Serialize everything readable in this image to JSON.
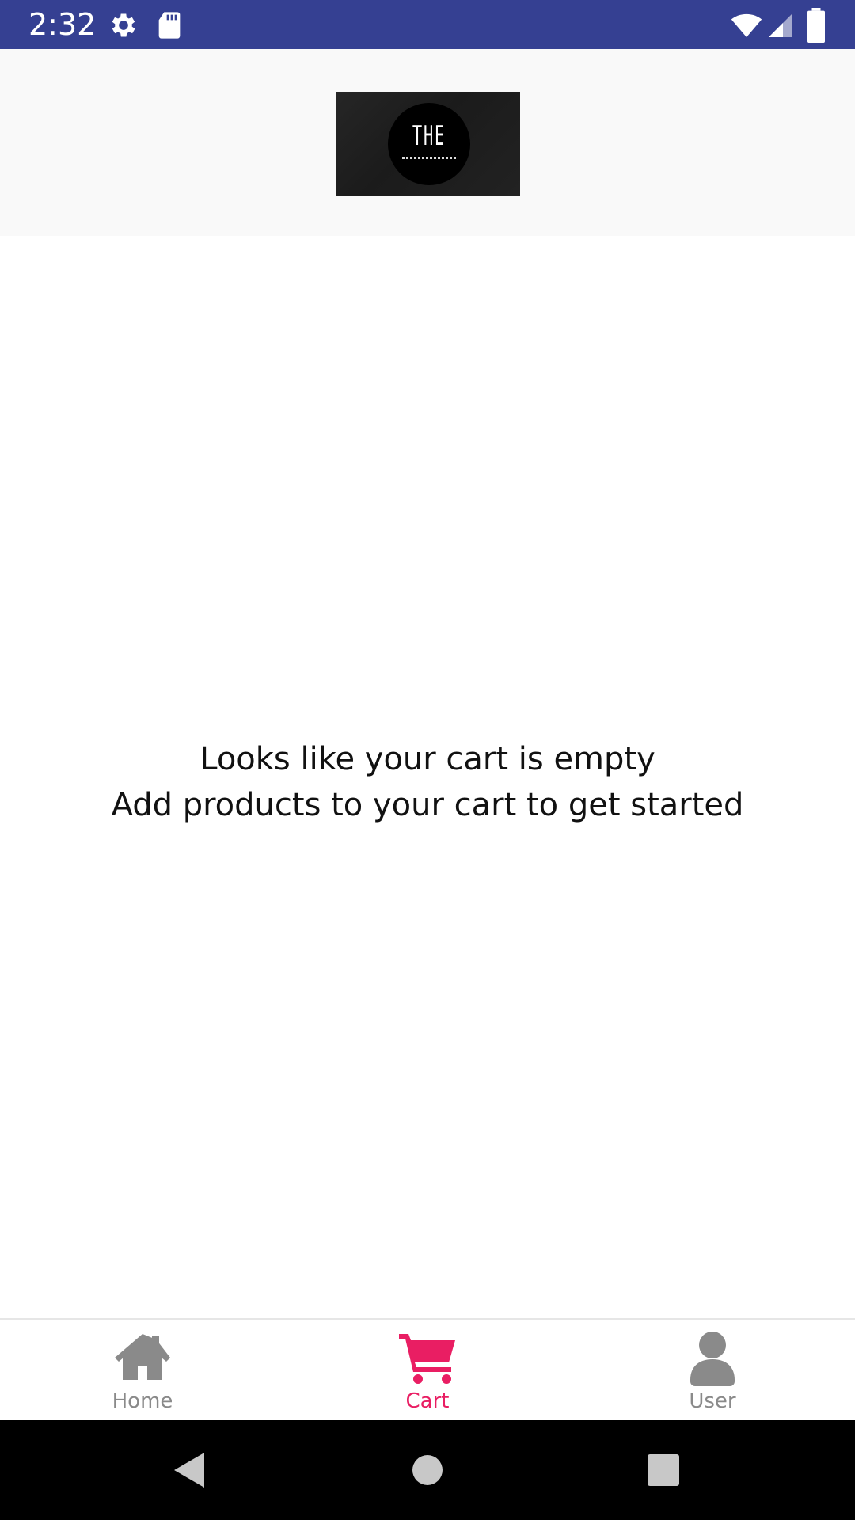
{
  "status_bar": {
    "time": "2:32",
    "icons": [
      "gear-icon",
      "sd-card-icon",
      "wifi-icon",
      "signal-icon",
      "battery-icon"
    ],
    "background_color": "#354092"
  },
  "header": {
    "logo_text": "THE",
    "logo_icon": "brand-logo"
  },
  "main": {
    "empty_title": "Looks like your cart is empty",
    "empty_subtitle": "Add products to your cart to get started"
  },
  "bottom_nav": {
    "active_color": "#e91e63",
    "inactive_color": "#8a8a8a",
    "items": [
      {
        "label": "Home",
        "icon": "home-icon",
        "active": false
      },
      {
        "label": "Cart",
        "icon": "cart-icon",
        "active": true
      },
      {
        "label": "User",
        "icon": "user-icon",
        "active": false
      }
    ]
  },
  "system_nav": {
    "buttons": [
      "back-icon",
      "home-circle-icon",
      "recents-icon"
    ]
  }
}
